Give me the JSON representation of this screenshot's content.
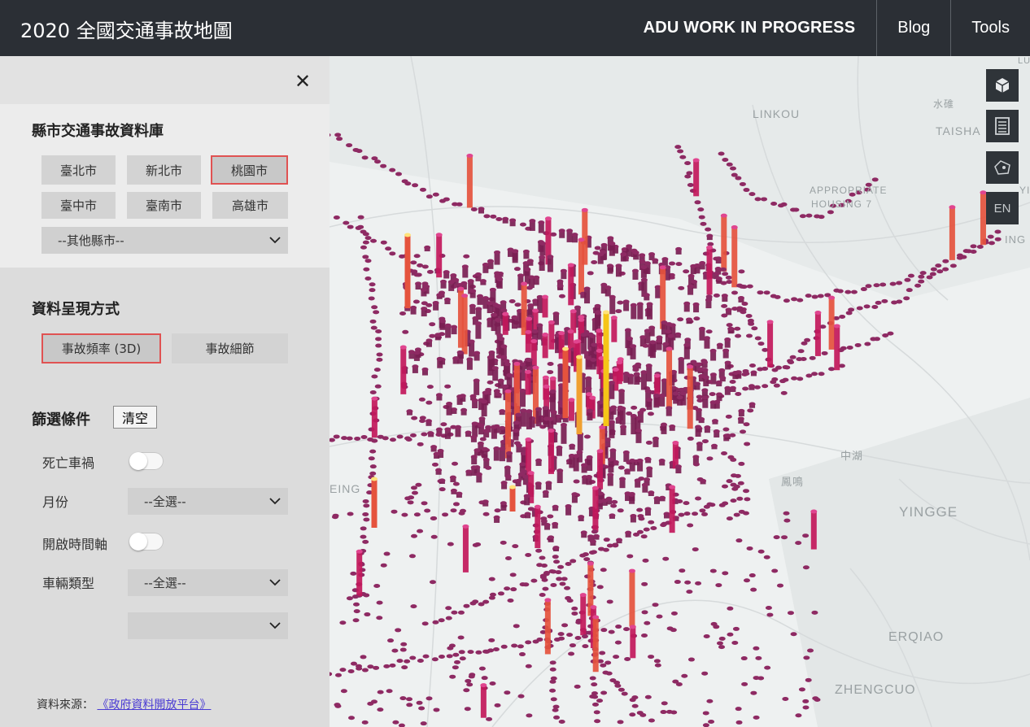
{
  "header": {
    "title": "2020 全國交通事故地圖",
    "brand": "ADU WORK IN PROGRESS",
    "links": [
      "Blog",
      "Tools"
    ]
  },
  "panel": {
    "close_icon": "close-icon",
    "database": {
      "title": "縣市交通事故資料庫",
      "cities": [
        "臺北市",
        "新北市",
        "桃園市",
        "臺中市",
        "臺南市",
        "高雄市"
      ],
      "active_city": "桃園市",
      "other_select": "--其他縣市--"
    },
    "display": {
      "title": "資料呈現方式",
      "modes": [
        "事故頻率 (3D)",
        "事故細節"
      ],
      "active_mode": "事故頻率 (3D)"
    },
    "filters": {
      "title": "篩選條件",
      "clear": "清空",
      "fatal_label": "死亡車禍",
      "fatal_on": false,
      "month_label": "月份",
      "month_value": "--全選--",
      "timeline_label": "開啟時間軸",
      "timeline_on": false,
      "vehicle_label": "車輛類型",
      "vehicle_value": "--全選--",
      "vehicle_sub_value": ""
    },
    "source": {
      "prefix": "資料來源：",
      "link": "《政府資料開放平台》"
    }
  },
  "map": {
    "labels": [
      "LINKOU",
      "水碓",
      "TAISHA",
      "APPROPRIATE",
      "HOUSING 7",
      "中湖",
      "鳳鳴",
      "YINGGE",
      "ERQIAO",
      "ZHENGCUO",
      "EING",
      "ING",
      "LU",
      "YI"
    ],
    "controls": [
      "3d-view-icon",
      "list-icon",
      "map-layer-icon",
      "EN"
    ],
    "colors": {
      "low": "#7a1e52",
      "mid": "#c2185b",
      "high": "#e5533d",
      "peak": "#f5c518"
    }
  }
}
